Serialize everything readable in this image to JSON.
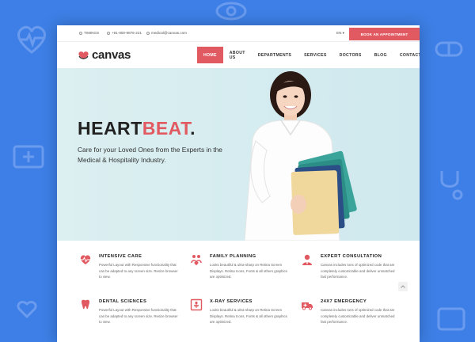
{
  "topbar": {
    "timings": "TIMINGS",
    "phone": "+91-800-9876-221",
    "email": "medical@canvas.com",
    "lang": "EN ▾",
    "cta": "BOOK AN APPOINTMENT"
  },
  "logo": {
    "text": "canvas"
  },
  "nav": {
    "items": [
      "HOME",
      "ABOUT US",
      "DEPARTMENTS",
      "SERVICES",
      "DOCTORS",
      "BLOG",
      "CONTACT"
    ],
    "active": "HOME"
  },
  "hero": {
    "title_main": "HEART",
    "title_accent": "BEAT",
    "title_dot": ".",
    "subtitle": "Care for your Loved Ones from the Experts in the Medical & Hospitality Industry."
  },
  "features": [
    {
      "icon": "heartbeat-icon",
      "title": "INTENSIVE CARE",
      "text": "Powerful Layout with Responsive functionality that can be adapted to any screen size. Resize browser to view."
    },
    {
      "icon": "family-icon",
      "title": "FAMILY PLANNING",
      "text": "Looks beautiful & ultra-sharp on Retina Screen Displays. Retina Icons, Fonts & all others graphics are optimized."
    },
    {
      "icon": "doctor-icon",
      "title": "EXPERT CONSULTATION",
      "text": "Canvas includes tons of optimized code that are completely customizable and deliver unmatched fast performance."
    },
    {
      "icon": "tooth-icon",
      "title": "DENTAL SCIENCES",
      "text": "Powerful Layout with Responsive functionality that can be adapted to any screen size. Resize browser to view."
    },
    {
      "icon": "xray-icon",
      "title": "X-RAY SERVICES",
      "text": "Looks beautiful & ultra-sharp on Retina Screen Displays. Retina Icons, Fonts & all others graphics are optimized."
    },
    {
      "icon": "ambulance-icon",
      "title": "24X7 EMERGENCY",
      "text": "Canvas includes tons of optimized code that are completely customizable and deliver unmatched fast performance."
    }
  ],
  "colors": {
    "accent": "#e15a61",
    "background": "#3d7fe6"
  }
}
